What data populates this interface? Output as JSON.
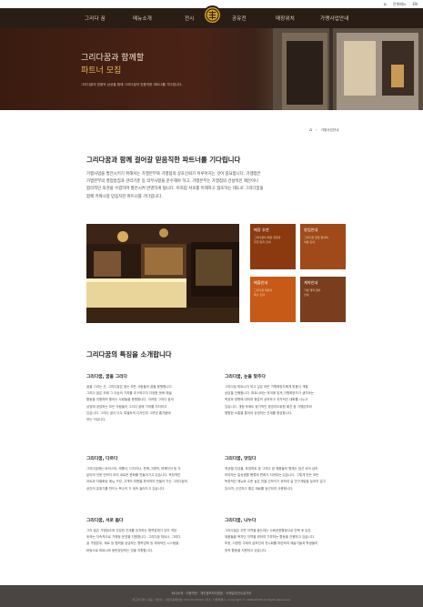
{
  "topbar": {
    "home": "홈",
    "member": "전체메뉴",
    "lang": "EN"
  },
  "nav": {
    "items": [
      "그리다 꿈",
      "메뉴소개",
      "전시",
      "공유전",
      "매장위치",
      "가맹사업안내"
    ]
  },
  "colors": {
    "nav_bg": "#2a1d16",
    "accent": "#e8b45a",
    "tile1": "#8b3a10",
    "tile2": "#a04a1a",
    "tile3": "#c75a16",
    "tile4": "#7a3e1e",
    "footer": "#4a4542"
  },
  "hero": {
    "title": "그리다꿈과 함께할",
    "subtitle": "파트너 모집",
    "desc": "그리다꿈의 믿음직 상상을 함께 그리다꿈의 믿음직한 파트너를 기다립니다."
  },
  "breadcrumb": {
    "home_icon": "home-icon",
    "current": "가맹사업안내"
  },
  "intro": {
    "title": "그리다꿈과 함께 걸어갈 믿음직한 파트너를 기다립니다",
    "lines": [
      "가맹사업을 발전시키기 위해서는 가맹본부와 가맹점의 상호신뢰가 이루어지는 것이 중요합니다. 가맹점은",
      "가맹본부의 영업방침과 관리기준 등 의무사항을 준수해야 하고, 가맹본부는 가맹점의 건설적인 제안이나",
      "합리적인 의견을 수렴하여 발전시켜 반영하게 됩니다. 이처럼 서로를 이해하고 협조하는 태도로 그리다꿈을",
      "함께 키워나갈 믿음직한 파트너를 기다립니다."
    ]
  },
  "tiles": [
    {
      "title": "매장 추천",
      "lines": [
        "그리다꿈의 매장 유형과",
        "추천 입지 안내"
      ]
    },
    {
      "title": "창업안내",
      "lines": [
        "그리다꿈 창업 절차와",
        "비용 안내"
      ]
    },
    {
      "title": "매출안내",
      "lines": [
        "그리다꿈 매장의",
        "매출 안내"
      ]
    },
    {
      "title": "계약안내",
      "lines": [
        "가맹 계약 절차",
        "안내"
      ]
    }
  ],
  "features": {
    "title": "그리다꿈의 특징을 소개합니다",
    "items": [
      {
        "title": "그리다꿈, 꿈을 그리다",
        "lines": [
          "꿈을 그리는 곳, 그리다꿈은 찾는 모든 사람들의 꿈을 응원합니다.",
          "그리다 꿈은 카페 그 이상의 가치를 추구하고자 다양한 문화 예술",
          "활동을 지원하며 좋아는 사람들을 응원합니다. 이러한 그리다 꿈의",
          "상징에 공감하는 모든 사람들이 그리다 꿈에 가치를 지지하고",
          "있습니다. 그리다 꿈이 다두 특별하게 디자인과 그려낸 즐거움에",
          "보는 이입니다."
        ]
      },
      {
        "title": "그리다꿈, 눈을 맞추다",
        "lines": [
          "그리다꿈 파트너가 되고 싶은 모든 가맹희망자에게 맞춤식 개별",
          "상담을 진행합니다. 파트너라는 의미에 맞게 가맹희망자가 생각하는",
          "목표와 방향에 대하여 충분히 상의하고 지자적인 대화를 나누고",
          "있습니다. 개점 후에도 정기적인 경영지도위원 회진 등 가맹본부와",
          "원활한 소통을 통하여 상생하는 관계를 형성합니다."
        ]
      },
      {
        "title": "그리다꿈, 다르다",
        "lines": [
          "그리다꿈에는 바리스타, 제빵사, 디자이너, 판매,그래픽, 마케터아 등 각",
          "분야의 전문 인력이 모여 새로운 문화를 만들어가고 있습니다. 독창적인",
          "아트와 차별화된 메뉴 구성, 고객의 취향을 파악하여 만들어 가는 그리다꿈의",
          "공간의 분위기를 만드는 복수의 가 계속 놀러드고 있습니다."
        ]
      },
      {
        "title": "그리다꿈, 맛있다",
        "lines": [
          "최상밸 건강을, 포장파트 등 그리다 꿈 제품들의 원재는 엄선 되어 남리",
          "하여하는 일상생활 빵류에 변화가 지켜되는 있습니다. 그렇게 만든 모든",
          "독창적인 메뉴와 수준 높은 맛을 선보이기 위하여 늘 연구개발을 늘하지 않고",
          "있으며, 신선하고 좋은 재료를 엄선하여 사용합니다."
        ]
      },
      {
        "title": "그리다꿈, 서로 돕다",
        "lines": [
          "그리 꿈은 가맹점주와 건강한 관계를 유지하는 협력업체가 있어 격앙",
          "후에는 지속적으로 가맹점 운영을 지원합니다. 그리다꿈 파트너, 그리다",
          "꿈 가맹본부, 제로 등 협력을 공급하는 협력업체 등 체계적인 시스템을",
          "바탕으로 파트너와 동반성장하는 것을 지향합니다."
        ]
      },
      {
        "title": "그리다꿈, 나누다",
        "lines": [
          "그리다꿈은 주변 지역을 돕는데는 사회공헌활동으로 빈북 후 남은",
          "제품들을 복지단 지역을 위하여 기부하는 활동을 진행하고 있습니다.",
          "또한, 다양한 주제의 공모전과 전시회를 마련하여 예술가들과 학생들의",
          "창작 활동을 지원하고 있습니다."
        ]
      }
    ]
  },
  "footer": {
    "links": "회사소개  ·  이용약관  ·  개인정보처리방침  ·  이메일무단수집거부",
    "info": "㈜그리다꿈  |  대표: 이찬우  |  사업자등록번호: 000-00-00000  |  주소: 서울특별시  |  Copyright © GRIDAKKUM All Rights Reserved."
  }
}
